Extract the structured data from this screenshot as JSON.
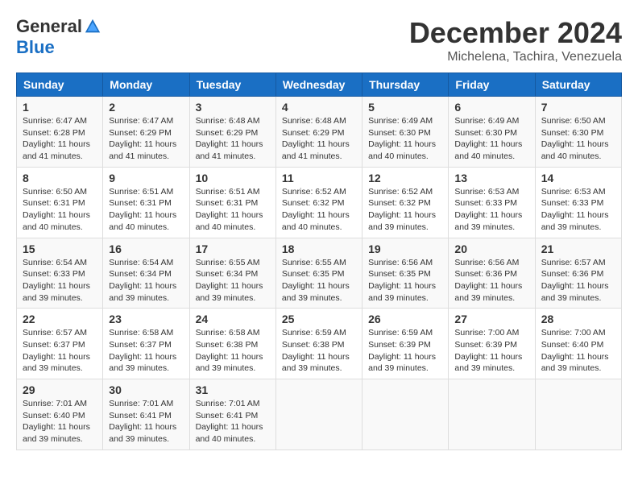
{
  "logo": {
    "general": "General",
    "blue": "Blue"
  },
  "title": "December 2024",
  "location": "Michelena, Tachira, Venezuela",
  "headers": [
    "Sunday",
    "Monday",
    "Tuesday",
    "Wednesday",
    "Thursday",
    "Friday",
    "Saturday"
  ],
  "weeks": [
    [
      {
        "day": "1",
        "sunrise": "6:47 AM",
        "sunset": "6:28 PM",
        "daylight": "11 hours and 41 minutes."
      },
      {
        "day": "2",
        "sunrise": "6:47 AM",
        "sunset": "6:29 PM",
        "daylight": "11 hours and 41 minutes."
      },
      {
        "day": "3",
        "sunrise": "6:48 AM",
        "sunset": "6:29 PM",
        "daylight": "11 hours and 41 minutes."
      },
      {
        "day": "4",
        "sunrise": "6:48 AM",
        "sunset": "6:29 PM",
        "daylight": "11 hours and 41 minutes."
      },
      {
        "day": "5",
        "sunrise": "6:49 AM",
        "sunset": "6:30 PM",
        "daylight": "11 hours and 40 minutes."
      },
      {
        "day": "6",
        "sunrise": "6:49 AM",
        "sunset": "6:30 PM",
        "daylight": "11 hours and 40 minutes."
      },
      {
        "day": "7",
        "sunrise": "6:50 AM",
        "sunset": "6:30 PM",
        "daylight": "11 hours and 40 minutes."
      }
    ],
    [
      {
        "day": "8",
        "sunrise": "6:50 AM",
        "sunset": "6:31 PM",
        "daylight": "11 hours and 40 minutes."
      },
      {
        "day": "9",
        "sunrise": "6:51 AM",
        "sunset": "6:31 PM",
        "daylight": "11 hours and 40 minutes."
      },
      {
        "day": "10",
        "sunrise": "6:51 AM",
        "sunset": "6:31 PM",
        "daylight": "11 hours and 40 minutes."
      },
      {
        "day": "11",
        "sunrise": "6:52 AM",
        "sunset": "6:32 PM",
        "daylight": "11 hours and 40 minutes."
      },
      {
        "day": "12",
        "sunrise": "6:52 AM",
        "sunset": "6:32 PM",
        "daylight": "11 hours and 39 minutes."
      },
      {
        "day": "13",
        "sunrise": "6:53 AM",
        "sunset": "6:33 PM",
        "daylight": "11 hours and 39 minutes."
      },
      {
        "day": "14",
        "sunrise": "6:53 AM",
        "sunset": "6:33 PM",
        "daylight": "11 hours and 39 minutes."
      }
    ],
    [
      {
        "day": "15",
        "sunrise": "6:54 AM",
        "sunset": "6:33 PM",
        "daylight": "11 hours and 39 minutes."
      },
      {
        "day": "16",
        "sunrise": "6:54 AM",
        "sunset": "6:34 PM",
        "daylight": "11 hours and 39 minutes."
      },
      {
        "day": "17",
        "sunrise": "6:55 AM",
        "sunset": "6:34 PM",
        "daylight": "11 hours and 39 minutes."
      },
      {
        "day": "18",
        "sunrise": "6:55 AM",
        "sunset": "6:35 PM",
        "daylight": "11 hours and 39 minutes."
      },
      {
        "day": "19",
        "sunrise": "6:56 AM",
        "sunset": "6:35 PM",
        "daylight": "11 hours and 39 minutes."
      },
      {
        "day": "20",
        "sunrise": "6:56 AM",
        "sunset": "6:36 PM",
        "daylight": "11 hours and 39 minutes."
      },
      {
        "day": "21",
        "sunrise": "6:57 AM",
        "sunset": "6:36 PM",
        "daylight": "11 hours and 39 minutes."
      }
    ],
    [
      {
        "day": "22",
        "sunrise": "6:57 AM",
        "sunset": "6:37 PM",
        "daylight": "11 hours and 39 minutes."
      },
      {
        "day": "23",
        "sunrise": "6:58 AM",
        "sunset": "6:37 PM",
        "daylight": "11 hours and 39 minutes."
      },
      {
        "day": "24",
        "sunrise": "6:58 AM",
        "sunset": "6:38 PM",
        "daylight": "11 hours and 39 minutes."
      },
      {
        "day": "25",
        "sunrise": "6:59 AM",
        "sunset": "6:38 PM",
        "daylight": "11 hours and 39 minutes."
      },
      {
        "day": "26",
        "sunrise": "6:59 AM",
        "sunset": "6:39 PM",
        "daylight": "11 hours and 39 minutes."
      },
      {
        "day": "27",
        "sunrise": "7:00 AM",
        "sunset": "6:39 PM",
        "daylight": "11 hours and 39 minutes."
      },
      {
        "day": "28",
        "sunrise": "7:00 AM",
        "sunset": "6:40 PM",
        "daylight": "11 hours and 39 minutes."
      }
    ],
    [
      {
        "day": "29",
        "sunrise": "7:01 AM",
        "sunset": "6:40 PM",
        "daylight": "11 hours and 39 minutes."
      },
      {
        "day": "30",
        "sunrise": "7:01 AM",
        "sunset": "6:41 PM",
        "daylight": "11 hours and 39 minutes."
      },
      {
        "day": "31",
        "sunrise": "7:01 AM",
        "sunset": "6:41 PM",
        "daylight": "11 hours and 40 minutes."
      },
      null,
      null,
      null,
      null
    ]
  ]
}
